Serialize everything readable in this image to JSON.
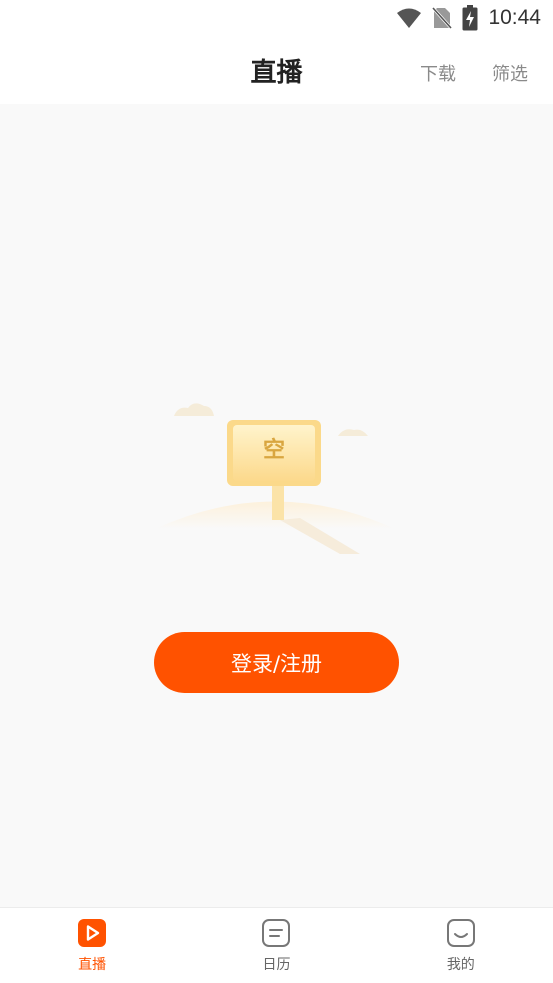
{
  "status_bar": {
    "time": "10:44",
    "icons": [
      "wifi-icon",
      "no-sim-icon",
      "battery-charging-icon"
    ]
  },
  "header": {
    "title": "直播",
    "download_label": "下载",
    "filter_label": "筛选"
  },
  "empty_state": {
    "sign_text": "空",
    "login_button_label": "登录/注册"
  },
  "bottom_nav": {
    "items": [
      {
        "label": "直播",
        "icon": "live-play-icon",
        "active": true
      },
      {
        "label": "日历",
        "icon": "calendar-icon",
        "active": false
      },
      {
        "label": "我的",
        "icon": "profile-face-icon",
        "active": false
      }
    ]
  },
  "colors": {
    "accent": "#ff5200",
    "header_action": "#8a8a8a",
    "content_bg": "#f9f9f9",
    "sign_yellow": "#fde7a6"
  }
}
